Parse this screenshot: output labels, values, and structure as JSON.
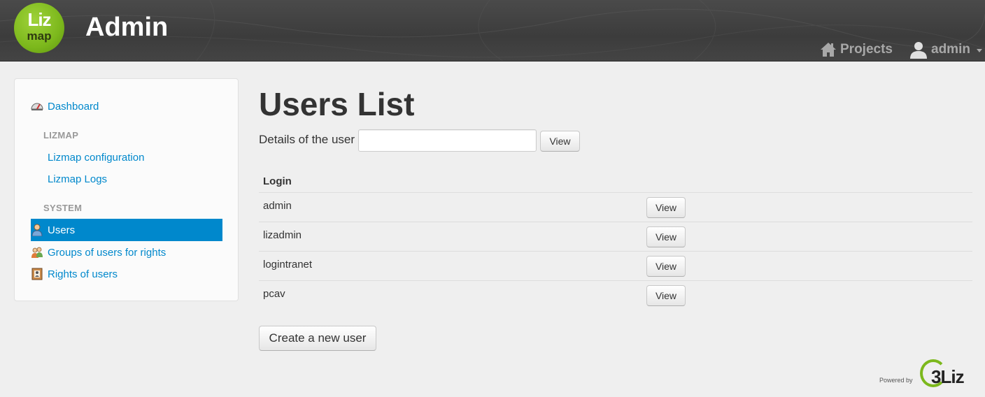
{
  "header": {
    "logo": {
      "line1": "Liz",
      "line2": "map"
    },
    "title": "Admin",
    "nav": {
      "projects_label": "Projects",
      "projects_icon": "home-icon",
      "user_label": "admin",
      "user_icon": "user-icon"
    }
  },
  "sidebar": {
    "items": [
      {
        "label": "Dashboard",
        "icon": "dashboard-icon"
      },
      {
        "header": "LIZMAP"
      },
      {
        "label": "Lizmap configuration"
      },
      {
        "label": "Lizmap Logs"
      },
      {
        "header": "SYSTEM"
      },
      {
        "label": "Users",
        "icon": "users-icon",
        "active": true
      },
      {
        "label": "Groups of users for rights",
        "icon": "groups-icon"
      },
      {
        "label": "Rights of users",
        "icon": "rights-icon"
      }
    ]
  },
  "main": {
    "title": "Users List",
    "details": {
      "label": "Details of the user",
      "input_value": "",
      "button_label": "View"
    },
    "table": {
      "header": "Login",
      "rows": [
        {
          "login": "admin",
          "action": "View"
        },
        {
          "login": "lizadmin",
          "action": "View"
        },
        {
          "login": "logintranet",
          "action": "View"
        },
        {
          "login": "pcav",
          "action": "View"
        }
      ]
    },
    "create_button": "Create a new user"
  },
  "footer": {
    "powered_by": "Powered by",
    "brand": "3Liz"
  },
  "colors": {
    "accent": "#0088cc",
    "header_bg": "#444444",
    "logo_green": "#7cb81c"
  }
}
